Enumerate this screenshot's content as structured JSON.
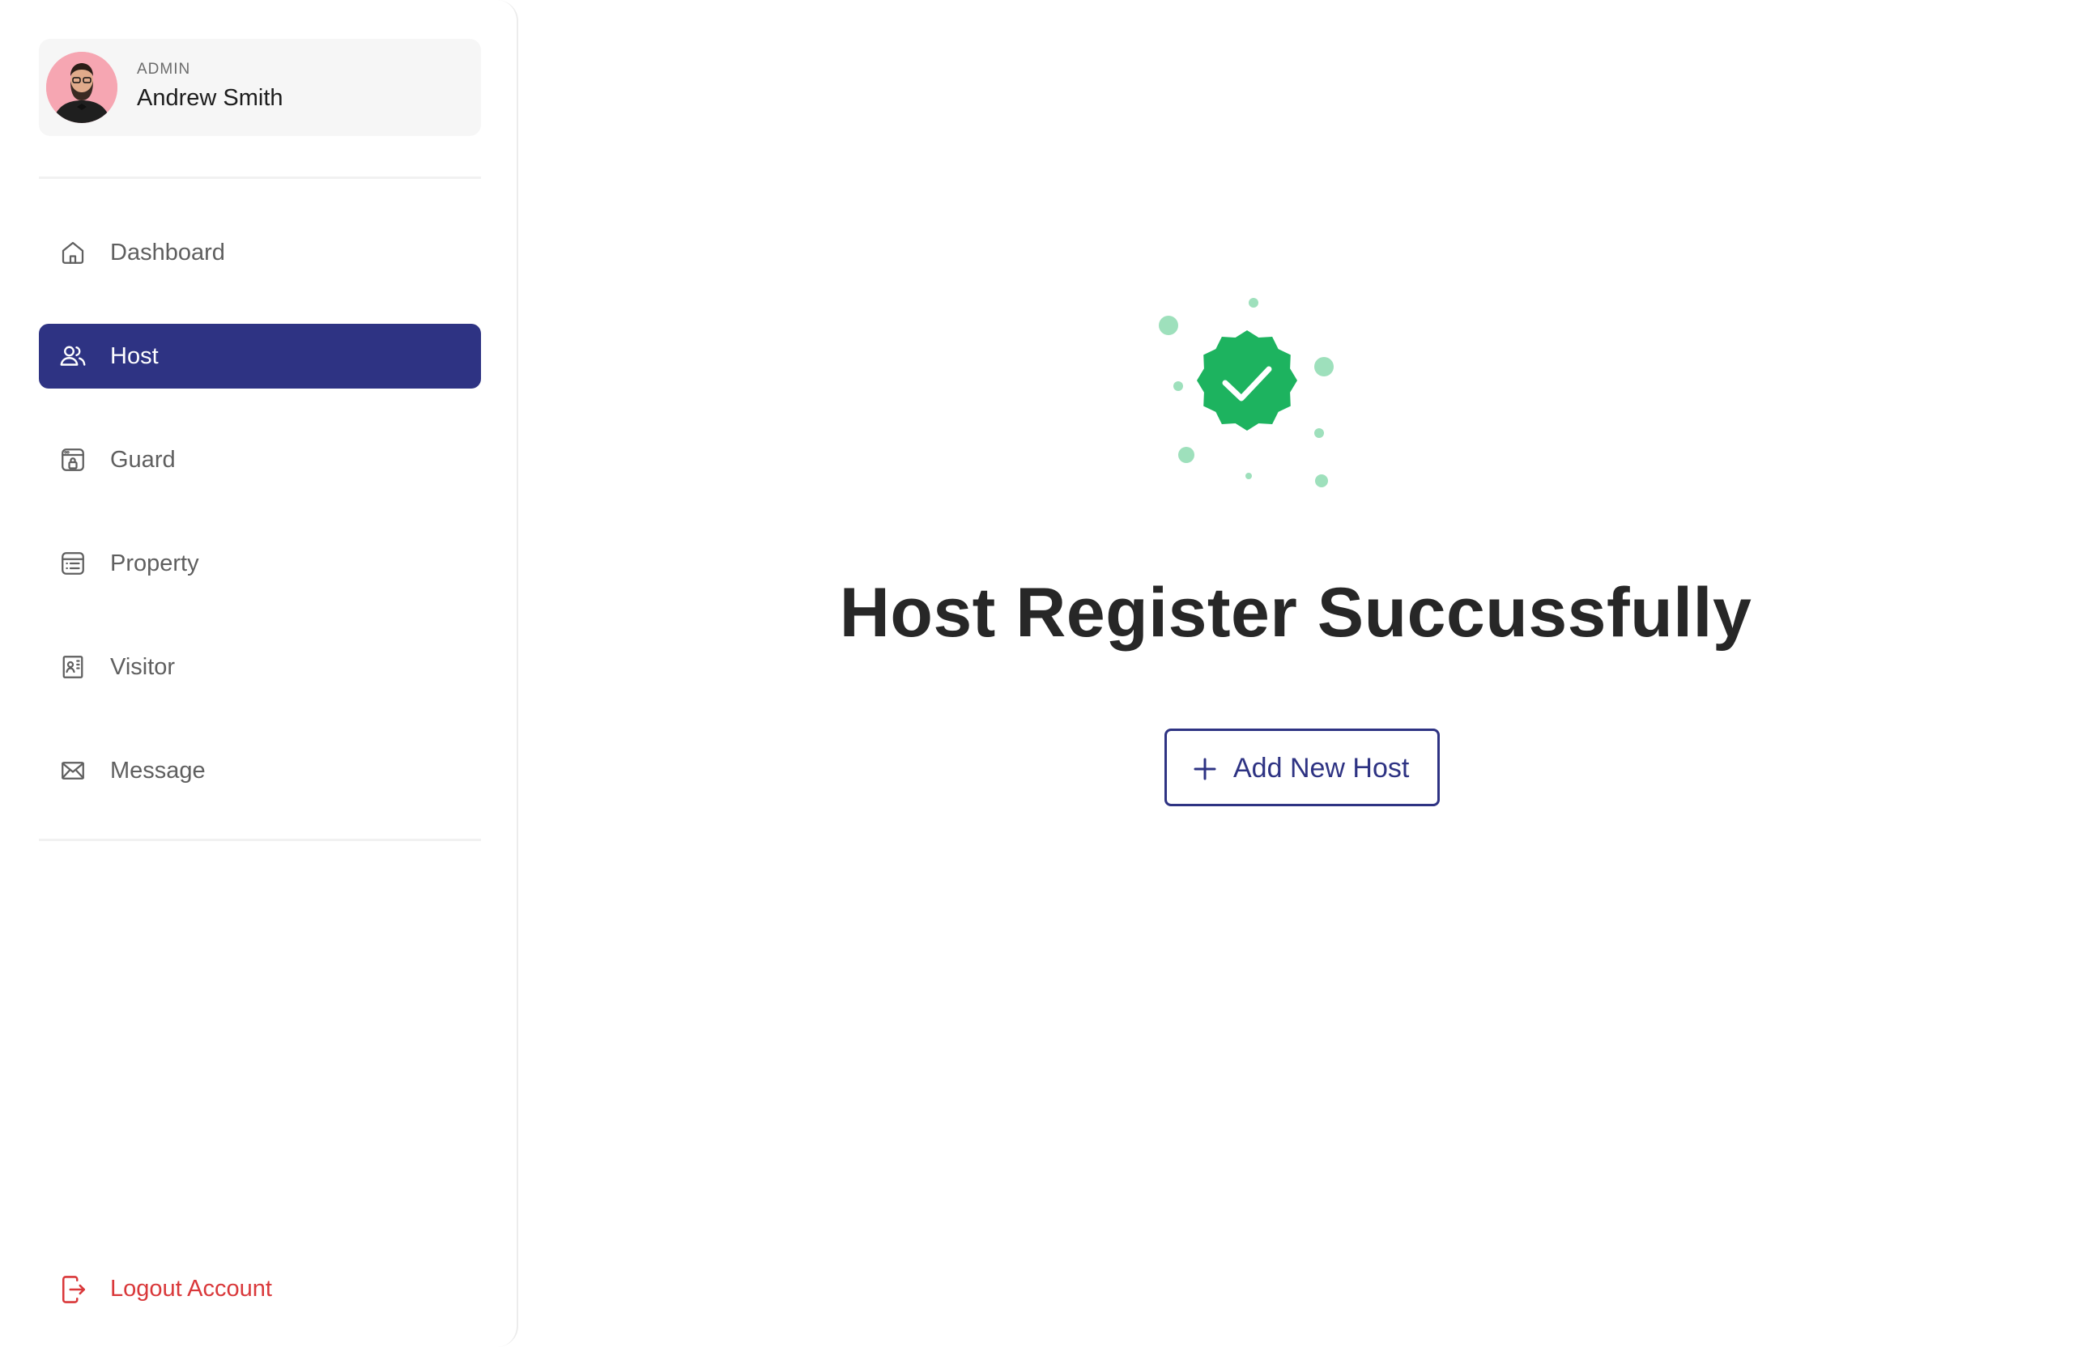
{
  "sidebar": {
    "profile": {
      "role": "ADMIN",
      "name": "Andrew Smith"
    },
    "items": [
      {
        "label": "Dashboard",
        "icon": "home-icon",
        "active": false
      },
      {
        "label": "Host",
        "icon": "users-icon",
        "active": true
      },
      {
        "label": "Guard",
        "icon": "guard-icon",
        "active": false
      },
      {
        "label": "Property",
        "icon": "property-icon",
        "active": false
      },
      {
        "label": "Visitor",
        "icon": "visitor-icon",
        "active": false
      },
      {
        "label": "Message",
        "icon": "mail-icon",
        "active": false
      }
    ],
    "logout": {
      "label": "Logout Account",
      "icon": "logout-icon"
    }
  },
  "main": {
    "success_icon": "verified-check-icon",
    "title": "Host Register Succussfully",
    "add_button": {
      "label": "Add New Host",
      "icon": "plus-icon"
    }
  },
  "colors": {
    "primary": "#2e3383",
    "success": "#1db35f",
    "success_dots": "#9ee0bc",
    "logout": "#d9383a",
    "text_muted": "#5f5f5f",
    "title": "#272727"
  }
}
